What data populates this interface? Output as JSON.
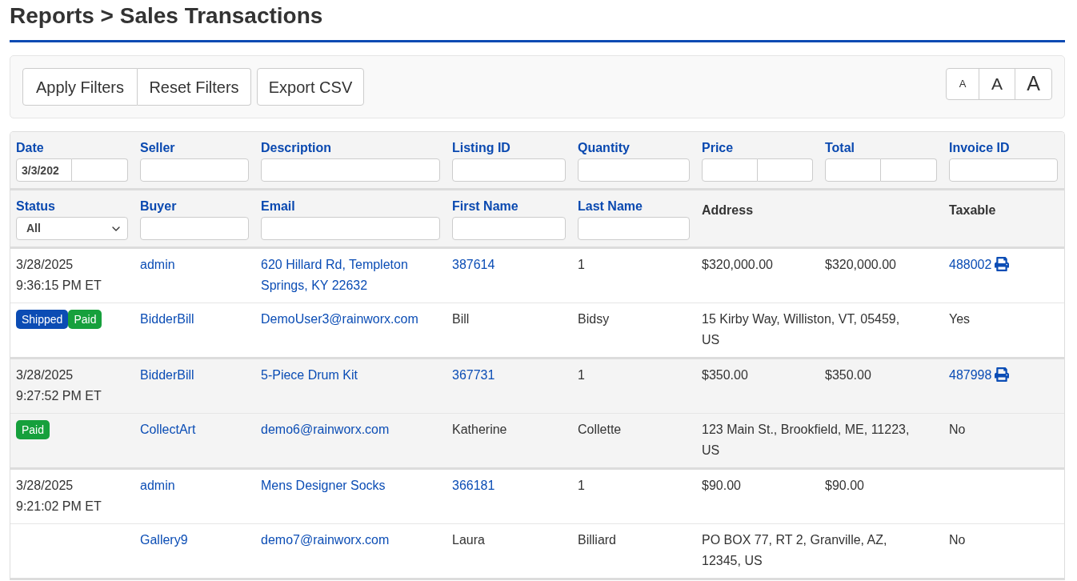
{
  "page_title": "Reports > Sales Transactions",
  "toolbar": {
    "filter_buttons": [
      "Apply Filters",
      "Reset Filters"
    ],
    "export_button": "Export CSV",
    "text_size_buttons": [
      {
        "label": "A",
        "kind": "small"
      },
      {
        "label": "A",
        "kind": "medium"
      },
      {
        "label": "A",
        "kind": "large"
      }
    ]
  },
  "filter_rows": [
    [
      {
        "label": "Date",
        "kind": "range",
        "from_value": "3/3/202"
      },
      {
        "label": "Seller",
        "kind": "text"
      },
      {
        "label": "Description",
        "kind": "text"
      },
      {
        "label": "Listing ID",
        "kind": "text"
      },
      {
        "label": "Quantity",
        "kind": "text"
      },
      {
        "label": "Price",
        "kind": "range"
      },
      {
        "label": "Total",
        "kind": "range"
      },
      {
        "label": "Invoice ID",
        "kind": "text"
      }
    ],
    [
      {
        "label": "Status",
        "kind": "select",
        "value": "All"
      },
      {
        "label": "Buyer",
        "kind": "text"
      },
      {
        "label": "Email",
        "kind": "text"
      },
      {
        "label": "First Name",
        "kind": "text"
      },
      {
        "label": "Last Name",
        "kind": "text"
      },
      {
        "label": "Address",
        "kind": "plain"
      },
      {
        "label": "Taxable",
        "kind": "plain"
      }
    ]
  ],
  "transactions": [
    {
      "date": "3/28/2025",
      "time": "9:36:15 PM ET",
      "seller": "admin",
      "description": "620 Hillard Rd, Templeton Springs, KY 22632",
      "listing_id": "387614",
      "quantity": "1",
      "price": "$320,000.00",
      "total": "$320,000.00",
      "invoice_id": "488002",
      "statuses": [
        {
          "label": "Shipped",
          "color": "#0b4cb4"
        },
        {
          "label": "Paid",
          "color": "#16a03c"
        }
      ],
      "buyer": "BidderBill",
      "email": "DemoUser3@rainworx.com",
      "first_name": "Bill",
      "last_name": "Bidsy",
      "address": "15 Kirby Way, Williston, VT, 05459, US",
      "taxable": "Yes"
    },
    {
      "date": "3/28/2025",
      "time": "9:27:52 PM ET",
      "seller": "BidderBill",
      "description": "5-Piece Drum Kit",
      "listing_id": "367731",
      "quantity": "1",
      "price": "$350.00",
      "total": "$350.00",
      "invoice_id": "487998",
      "statuses": [
        {
          "label": "Paid",
          "color": "#16a03c"
        }
      ],
      "buyer": "CollectArt",
      "email": "demo6@rainworx.com",
      "first_name": "Katherine",
      "last_name": "Collette",
      "address": "123 Main St., Brookfield, ME, 11223, US",
      "taxable": "No"
    },
    {
      "date": "3/28/2025",
      "time": "9:21:02 PM ET",
      "seller": "admin",
      "description": "Mens Designer Socks",
      "listing_id": "366181",
      "quantity": "1",
      "price": "$90.00",
      "total": "$90.00",
      "buyer": "Gallery9",
      "email": "demo7@rainworx.com",
      "first_name": "Laura",
      "last_name": "Billiard",
      "address": "PO BOX 77, RT 2, Granville, AZ, 12345, US",
      "taxable": "No"
    }
  ]
}
